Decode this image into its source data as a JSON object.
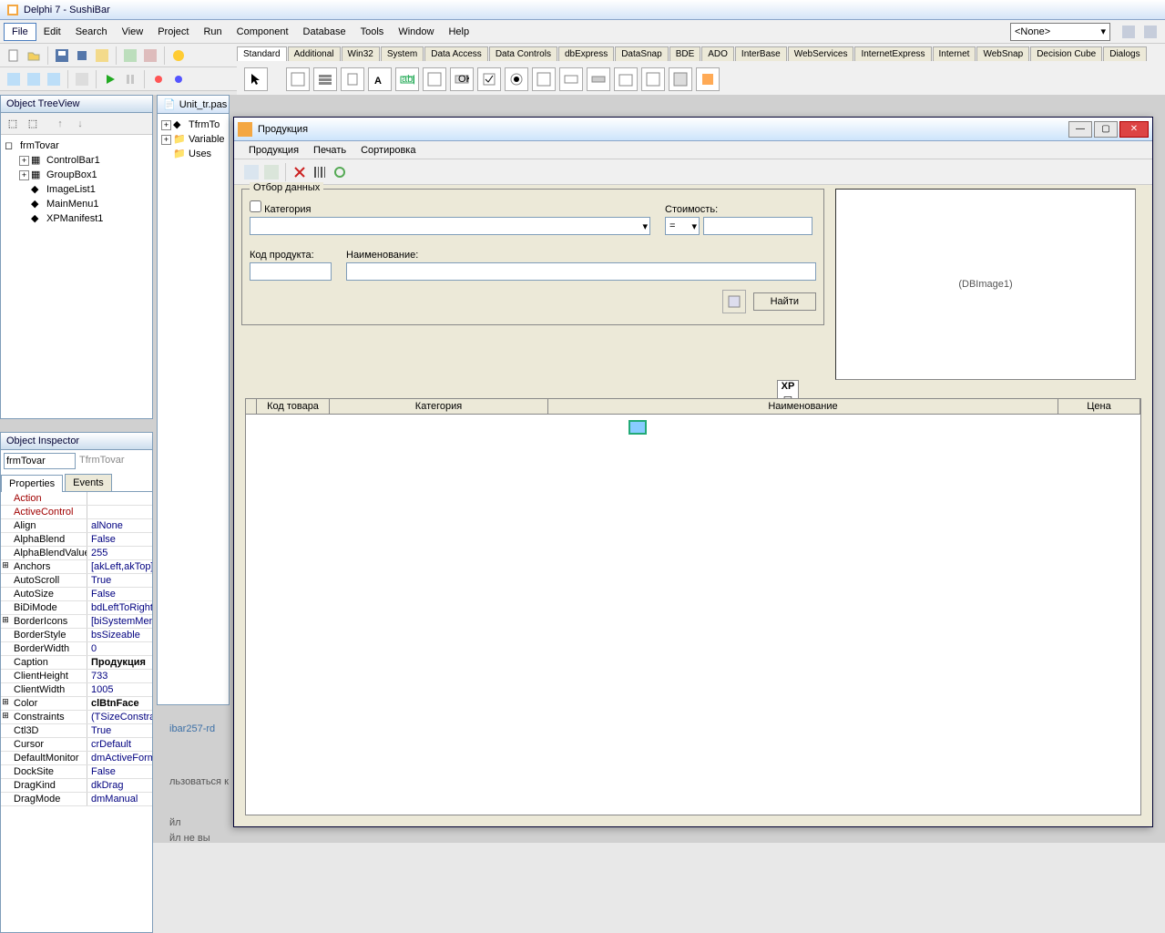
{
  "app": {
    "title": "Delphi 7 - SushiBar"
  },
  "menus": [
    "File",
    "Edit",
    "Search",
    "View",
    "Project",
    "Run",
    "Component",
    "Database",
    "Tools",
    "Window",
    "Help"
  ],
  "combo_none": "<None>",
  "palette_tabs": [
    "Standard",
    "Additional",
    "Win32",
    "System",
    "Data Access",
    "Data Controls",
    "dbExpress",
    "DataSnap",
    "BDE",
    "ADO",
    "InterBase",
    "WebServices",
    "InternetExpress",
    "Internet",
    "WebSnap",
    "Decision Cube",
    "Dialogs"
  ],
  "treeview": {
    "title": "Object TreeView",
    "root": "frmTovar",
    "children": [
      "ControlBar1",
      "GroupBox1",
      "ImageList1",
      "MainMenu1",
      "XPManifest1"
    ]
  },
  "inspector": {
    "title": "Object Inspector",
    "obj": "frmTovar",
    "cls": "TfrmTovar",
    "tabs": [
      "Properties",
      "Events"
    ],
    "props": [
      {
        "p": "Action",
        "v": "",
        "red": true
      },
      {
        "p": "ActiveControl",
        "v": "",
        "red": true
      },
      {
        "p": "Align",
        "v": "alNone"
      },
      {
        "p": "AlphaBlend",
        "v": "False"
      },
      {
        "p": "AlphaBlendValue",
        "v": "255"
      },
      {
        "p": "Anchors",
        "v": "[akLeft,akTop]",
        "exp": true
      },
      {
        "p": "AutoScroll",
        "v": "True"
      },
      {
        "p": "AutoSize",
        "v": "False"
      },
      {
        "p": "BiDiMode",
        "v": "bdLeftToRight"
      },
      {
        "p": "BorderIcons",
        "v": "[biSystemMenu",
        "exp": true
      },
      {
        "p": "BorderStyle",
        "v": "bsSizeable"
      },
      {
        "p": "BorderWidth",
        "v": "0"
      },
      {
        "p": "Caption",
        "v": "Продукция",
        "bold": true
      },
      {
        "p": "ClientHeight",
        "v": "733"
      },
      {
        "p": "ClientWidth",
        "v": "1005"
      },
      {
        "p": "Color",
        "v": "clBtnFace",
        "bold": true,
        "exp": true
      },
      {
        "p": "Constraints",
        "v": "(TSizeConstraints)",
        "exp": true
      },
      {
        "p": "Ctl3D",
        "v": "True"
      },
      {
        "p": "Cursor",
        "v": "crDefault"
      },
      {
        "p": "DefaultMonitor",
        "v": "dmActiveForm"
      },
      {
        "p": "DockSite",
        "v": "False"
      },
      {
        "p": "DragKind",
        "v": "dkDrag"
      },
      {
        "p": "DragMode",
        "v": "dmManual"
      }
    ]
  },
  "code_win": {
    "title": "Unit_tr.pas",
    "tree": [
      "TfrmTo",
      "Variable",
      "Uses"
    ]
  },
  "form": {
    "title": "Продукция",
    "menus": [
      "Продукция",
      "Печать",
      "Сортировка"
    ],
    "group_title": "Отбор данных",
    "chk_category": "Категория",
    "lbl_cost": "Стоимость:",
    "op_eq": "=",
    "lbl_code": "Код продукта:",
    "lbl_name": "Наименование:",
    "btn_find": "Найти",
    "image_placeholder": "(DBImage1)",
    "grid_cols": [
      "Код товара",
      "Категория",
      "Наименование",
      "Цена"
    ],
    "xp_label": "XP"
  },
  "bg_text": {
    "a": "ibar257-rd",
    "b": "льзоваться к",
    "c": "йл",
    "d": "йл не вы"
  }
}
